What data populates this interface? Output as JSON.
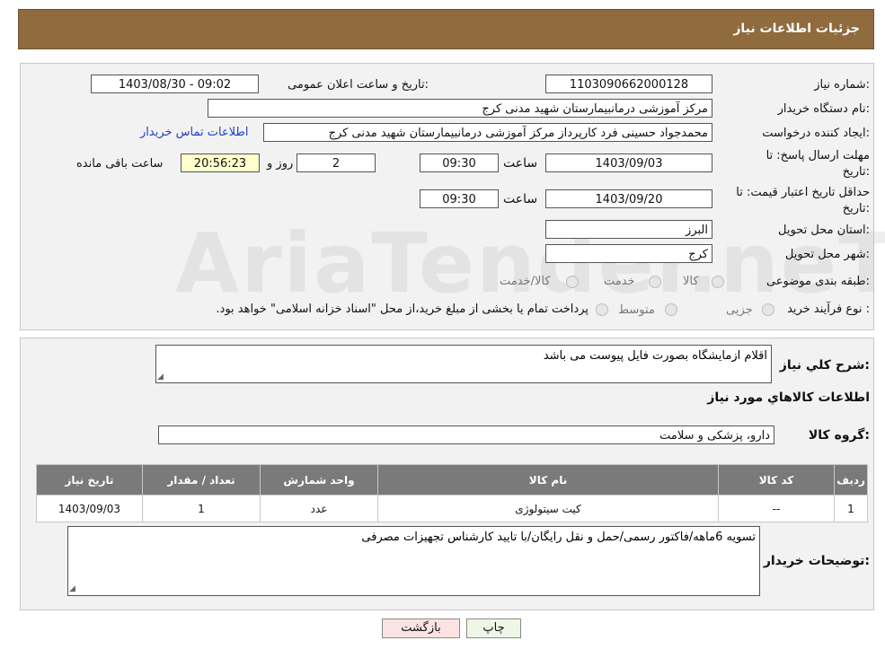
{
  "header": {
    "title": "جزئیات اطلاعات نیاز"
  },
  "form": {
    "need_number_label": "شماره نیاز:",
    "need_number": "1103090662000128",
    "announce_label": "تاریخ و ساعت اعلان عمومی:",
    "announce_value": "1403/08/30 - 09:02",
    "buyer_label": "نام دستگاه خریدار:",
    "buyer_value": "مرکز آموزشی درمانبیمارستان شهید مدنی کرج",
    "creator_label": "ایجاد کننده درخواست:",
    "creator_value": "محمدجواد حسینی فرد کارپرداز مرکز آموزشی درمانبیمارستان شهید مدنی کرج",
    "contact_link": "اطلاعات تماس خریدار",
    "deadline_label_1": "مهلت ارسال پاسخ: تا",
    "deadline_label_2": "تاریخ:",
    "deadline_date": "1403/09/03",
    "time_label": "ساعت",
    "deadline_time": "09:30",
    "days_value": "2",
    "days_label": "روز و",
    "remaining_value": "20:56:23",
    "remaining_label": "ساعت باقی مانده",
    "validity_label_1": "حداقل تاریخ اعتبار قیمت: تا",
    "validity_label_2": "تاریخ:",
    "validity_date": "1403/09/20",
    "validity_time": "09:30",
    "province_label": "استان محل تحویل:",
    "province_value": "البرز",
    "city_label": "شهر محل تحویل:",
    "city_value": "کرج",
    "category_label": "طبقه بندی موضوعی:",
    "category_options": [
      "کالا",
      "خدمت",
      "کالا/خدمت"
    ],
    "process_label": "نوع فرآیند خرید :",
    "process_options": [
      "جزیی",
      "متوسط"
    ],
    "process_note": "پرداخت تمام یا بخشی از مبلغ خرید،از محل \"اسناد خزانه اسلامی\" خواهد بود."
  },
  "details": {
    "description_label": "شرح کلي نياز:",
    "description_value": "اقلام ازمایشگاه بصورت فایل پیوست می باشد",
    "items_heading": "اطلاعات کالاهاي مورد نياز",
    "group_label": "گروه کالا:",
    "group_value": "دارو، پزشکی و سلامت",
    "table": {
      "headers": [
        "رديف",
        "کد کالا",
        "نام کالا",
        "واحد شمارش",
        "تعداد / مقدار",
        "تاريخ نياز"
      ],
      "rows": [
        [
          "1",
          "--",
          "کیت سیتولوژی",
          "عدد",
          "1",
          "1403/09/03"
        ]
      ]
    },
    "buyer_notes_label": "توضيحات خريدار:",
    "buyer_notes_value": "تسویه 6ماهه/فاکتور رسمی/حمل و نقل رایگان/با تایید کارشناس تجهیزات مصرفی"
  },
  "buttons": {
    "print": "چاپ",
    "back": "بازگشت"
  },
  "watermark": "AriaTender.neT"
}
